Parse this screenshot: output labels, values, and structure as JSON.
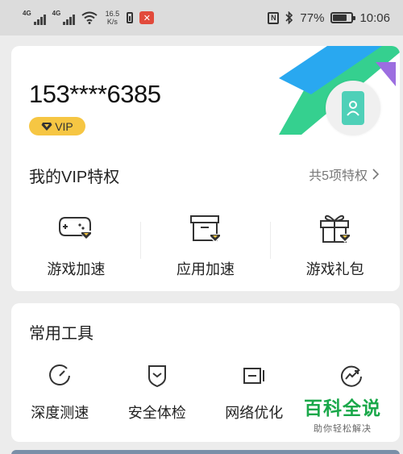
{
  "status_bar": {
    "sim1": "4G",
    "sim2": "4G",
    "speed_value": "16.5",
    "speed_unit": "K/s",
    "battery_percent": "77%",
    "battery_level": 0.77,
    "time": "10:06"
  },
  "account": {
    "phone": "153****6385",
    "vip_badge": "VIP"
  },
  "vip_section": {
    "title": "我的VIP特权",
    "more": "共5项特权",
    "items": [
      {
        "label": "游戏加速",
        "icon": "gamepad-icon"
      },
      {
        "label": "应用加速",
        "icon": "app-box-icon"
      },
      {
        "label": "游戏礼包",
        "icon": "gift-icon"
      }
    ]
  },
  "tools_section": {
    "title": "常用工具",
    "items": [
      {
        "label": "深度测速",
        "icon": "speedometer-icon"
      },
      {
        "label": "安全体检",
        "icon": "shield-icon"
      },
      {
        "label": "网络优化",
        "icon": "network-optimize-icon"
      },
      {
        "label": "",
        "icon": "trend-icon"
      }
    ]
  },
  "watermark": {
    "title": "百科全说",
    "subtitle": "助你轻松解决"
  },
  "colors": {
    "vip_gold": "#f6c643",
    "decor_blue": "#29a8f0",
    "decor_green": "#35d08f",
    "decor_purple": "#9c6ee0",
    "watermark_green": "#1aa84a"
  }
}
